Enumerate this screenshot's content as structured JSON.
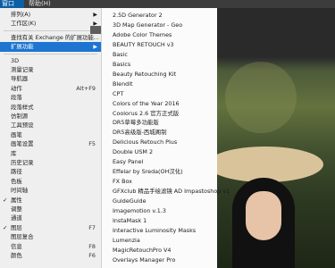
{
  "menubar": {
    "window": "窗口(W)",
    "help": "帮助(H)"
  },
  "menu_main": [
    {
      "label": "排列(A)",
      "arrow": true
    },
    {
      "label": "工作区(K)",
      "arrow": true
    },
    {
      "sep": true
    },
    {
      "label": "查找有关 Exchange 的扩展功能..."
    },
    {
      "label": "扩展功能",
      "arrow": true,
      "highlighted": true
    },
    {
      "sep": true
    },
    {
      "label": "3D"
    },
    {
      "label": "测量记录"
    },
    {
      "label": "导航器"
    },
    {
      "label": "动作",
      "shortcut": "Alt+F9"
    },
    {
      "label": "段落"
    },
    {
      "label": "段落样式"
    },
    {
      "label": "仿制源"
    },
    {
      "label": "工具预设"
    },
    {
      "label": "画笔"
    },
    {
      "label": "画笔设置",
      "shortcut": "F5"
    },
    {
      "label": "库"
    },
    {
      "label": "历史记录"
    },
    {
      "label": "路径"
    },
    {
      "label": "色板"
    },
    {
      "label": "时间轴"
    },
    {
      "label": "属性",
      "checked": true
    },
    {
      "label": "调整"
    },
    {
      "label": "通道"
    },
    {
      "label": "图层",
      "shortcut": "F7",
      "checked": true
    },
    {
      "label": "图层复合"
    },
    {
      "label": "信息",
      "shortcut": "F8"
    },
    {
      "label": "颜色",
      "shortcut": "F6"
    }
  ],
  "menu_extensions": [
    "2.5D Generator 2",
    "3D Map Generator - Geo",
    "Adobe Color Themes",
    "BEAUTY RETOUCH v3",
    "Basic",
    "Basics",
    "Beauty Retouching Kit",
    "Blendit",
    "CPT",
    "Colors of the Year 2016",
    "Coolorus 2.6 官方正式版",
    "DR5草莓多功能版",
    "DR5高级版-西城阁制",
    "Delicious Retouch Plus",
    "Double USM 2",
    "Easy Panel",
    "Effelar by Sreda(OH汉化)",
    "FX Box",
    "GFXclub 精品手绘滤镜 AD Impastoshop v1",
    "GuideGuide",
    "Imagemotion v.1.3",
    "InstaMask 1",
    "Interactive Luminosity Masks",
    "Lumenzia",
    "MagicRetouchPro V4",
    "Overlays Manager Pro"
  ],
  "colors": {
    "highlight": "#1d75d1",
    "menu_bg": "#efefef",
    "submenu_bg": "#fbfbfb",
    "menubar_active": "#0b5fa5"
  }
}
